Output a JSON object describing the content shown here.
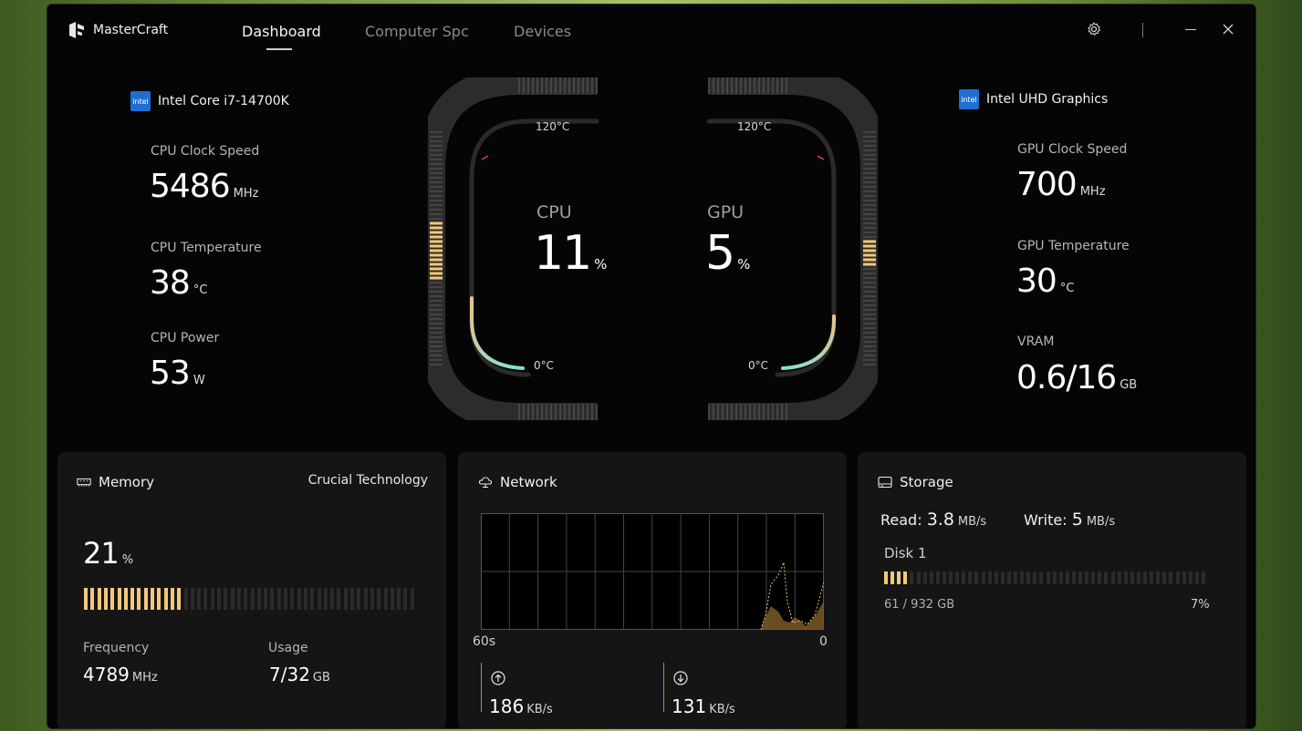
{
  "app": {
    "name": "MasterCraft",
    "tabs": [
      {
        "label": "Dashboard",
        "active": true
      },
      {
        "label": "Computer Spc",
        "active": false
      },
      {
        "label": "Devices",
        "active": false
      }
    ]
  },
  "cpu": {
    "name": "Intel Core i7-14700K",
    "badge": "intel",
    "clock_label": "CPU Clock Speed",
    "clock_value": "5486",
    "clock_unit": "MHz",
    "temp_label": "CPU Temperature",
    "temp_value": "38",
    "temp_unit": "°C",
    "power_label": "CPU Power",
    "power_value": "53",
    "power_unit": "W",
    "gauge_title": "CPU",
    "usage_value": "11",
    "usage_unit": "%",
    "gauge_max_label": "120°C",
    "gauge_min_label": "0°C",
    "temp_fraction": 0.32
  },
  "gpu": {
    "name": "Intel UHD Graphics",
    "badge": "intel",
    "clock_label": "GPU Clock Speed",
    "clock_value": "700",
    "clock_unit": "MHz",
    "temp_label": "GPU Temperature",
    "temp_value": "30",
    "temp_unit": "°C",
    "vram_label": "VRAM",
    "vram_value": "0.6/16",
    "vram_unit": "GB",
    "gauge_title": "GPU",
    "usage_value": "5",
    "usage_unit": "%",
    "gauge_max_label": "120°C",
    "gauge_min_label": "0°C",
    "temp_fraction": 0.25
  },
  "memory": {
    "title": "Memory",
    "brand": "Crucial Technology",
    "usage_value": "21",
    "usage_unit": "%",
    "usage_fraction": 0.21,
    "frequency_label": "Frequency",
    "frequency_value": "4789",
    "frequency_unit": "MHz",
    "usage_label": "Usage",
    "usage_gb_value": "7/32",
    "usage_gb_unit": "GB"
  },
  "network": {
    "title": "Network",
    "axis_left": "60s",
    "axis_right": "0",
    "upload_value": "186",
    "upload_unit": "KB/s",
    "download_value": "131",
    "download_unit": "KB/s"
  },
  "storage": {
    "title": "Storage",
    "read_label": "Read:",
    "read_value": "3.8",
    "read_unit": "MB/s",
    "write_label": "Write:",
    "write_value": "5",
    "write_unit": "MB/s",
    "disk_name": "Disk 1",
    "disk_used": "61 / 932 GB",
    "disk_percent": "7%",
    "disk_fraction": 0.07
  },
  "colors": {
    "accent": "#f5c77a",
    "accent_dim": "#2a2a2a",
    "teal": "#7fe3dc",
    "background": "#050505",
    "card": "#151515"
  }
}
